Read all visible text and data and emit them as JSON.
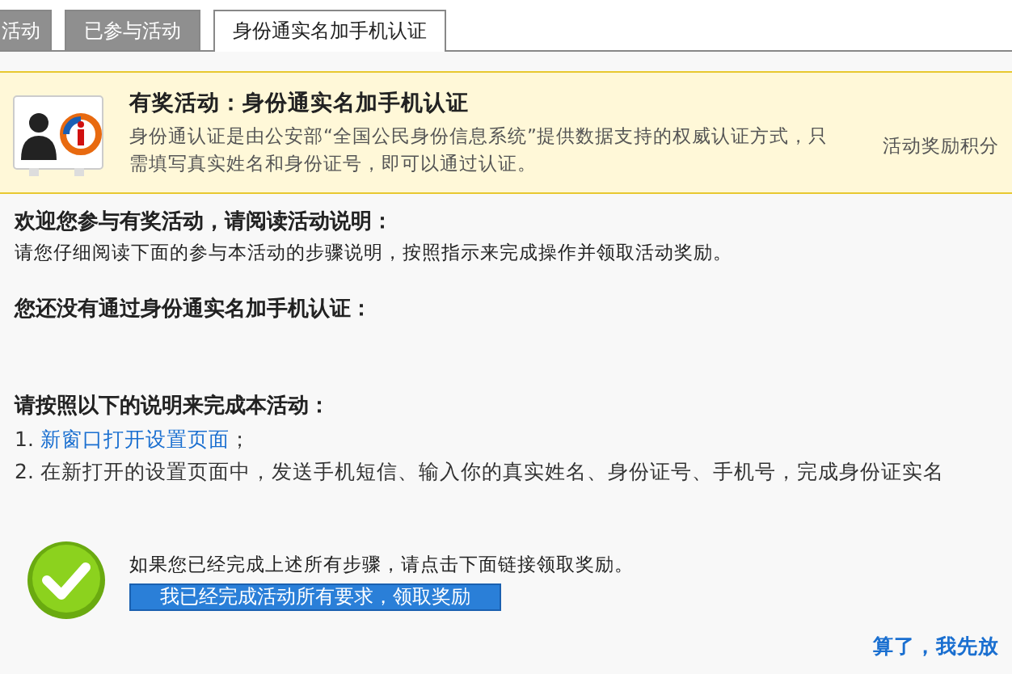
{
  "tabs": [
    {
      "label": "活动",
      "selected": false
    },
    {
      "label": "已参与活动",
      "selected": false
    },
    {
      "label": "身份通实名加手机认证",
      "selected": true
    }
  ],
  "banner": {
    "title": "有奖活动：身份通实名加手机认证",
    "description": "身份通认证是由公安部“全国公民身份信息系统”提供数据支持的权威认证方式，只需填写真实姓名和身份证号，即可以通过认证。",
    "side_label": "活动奖励积分"
  },
  "intro": {
    "heading": "欢迎您参与有奖活动，请阅读活动说明：",
    "text": "请您仔细阅读下面的参与本活动的步骤说明，按照指示来完成操作并领取活动奖励。"
  },
  "status": "您还没有通过身份通实名加手机认证：",
  "steps": {
    "heading": "请按照以下的说明来完成本活动：",
    "items": [
      {
        "number": "1.",
        "link": "新窗口打开设置页面",
        "text": "；"
      },
      {
        "number": "2.",
        "text": "在新打开的设置页面中，发送手机短信、输入你的真实姓名、身份证号、手机号，完成身份证实名"
      }
    ]
  },
  "claim": {
    "text": "如果您已经完成上述所有步骤，请点击下面链接领取奖励。",
    "button": "我已经完成活动所有要求，领取奖励"
  },
  "giveup": "算了，我先放"
}
